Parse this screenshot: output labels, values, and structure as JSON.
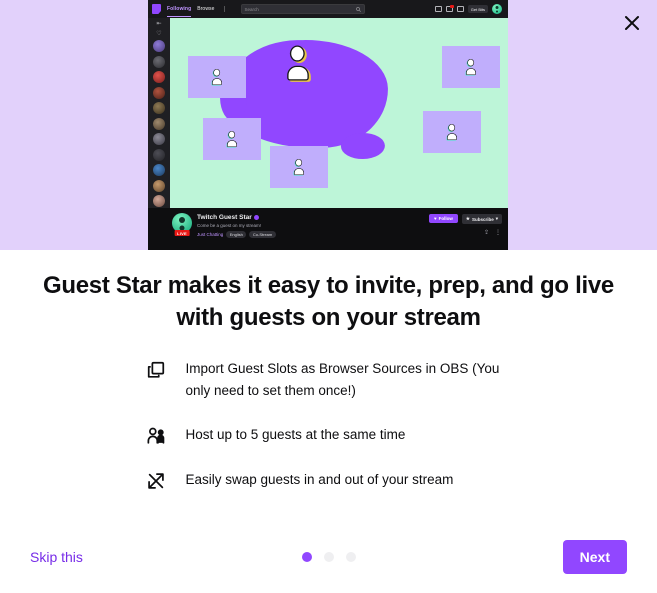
{
  "modal": {
    "close_label": "×",
    "close_icon": "close-icon"
  },
  "hero": {
    "nav": {
      "logo_icon": "twitch-logo-icon",
      "following_label": "Following",
      "browse_label": "Browse",
      "more_icon": "kebab-menu-icon",
      "search_placeholder": "Search",
      "search_icon": "search-icon",
      "prime_icon": "prime-crown-icon",
      "notifications_icon": "bell-icon",
      "whispers_icon": "message-icon",
      "bits_label": "Get Bits",
      "bits_icon": "bits-icon",
      "avatar_icon": "user-avatar"
    },
    "sidebar": {
      "collapse_icon": "collapse-sidebar-icon",
      "followed_icon": "heart-icon",
      "channel_count": 12
    },
    "stage": {
      "background_color": "#bdf5d8",
      "blob_color": "#9147ff",
      "slot_color": "#c0aefc",
      "guest_slots": 5,
      "host_label": "host"
    },
    "channel": {
      "name": "Twitch Guest Star",
      "verified_icon": "verified-badge-icon",
      "live_label": "LIVE",
      "stream_title": "Come be a guest on my stream!",
      "category": "Just Chatting",
      "tags": [
        "English",
        "Co-Stream"
      ],
      "follow_label": "Follow",
      "follow_icon": "heart-icon",
      "subscribe_label": "Subscribe",
      "subscribe_icon": "star-icon",
      "subscribe_chevron_icon": "chevron-down-icon",
      "share_icon": "share-icon",
      "more_icon": "kebab-menu-icon"
    }
  },
  "content": {
    "headline": "Guest Star makes it easy to invite, prep, and go live with guests on your stream",
    "features": [
      {
        "icon": "copy-duplicate-icon",
        "text": "Import Guest Slots as Browser Sources in OBS (You only need to set them once!)"
      },
      {
        "icon": "people-icon",
        "text": "Host up to 5 guests at the same time"
      },
      {
        "icon": "swap-arrows-icon",
        "text": "Easily swap guests in and out of your stream"
      }
    ]
  },
  "footer": {
    "skip_label": "Skip this",
    "next_label": "Next",
    "pagination": {
      "total": 3,
      "active_index": 0
    }
  },
  "colors": {
    "page_background": "#e2d1fb",
    "accent_purple": "#9147ff",
    "link_purple": "#772ce8",
    "card_background": "#ffffff",
    "mint_green": "#bdf5d8",
    "lavender_slot": "#c0aefc"
  }
}
